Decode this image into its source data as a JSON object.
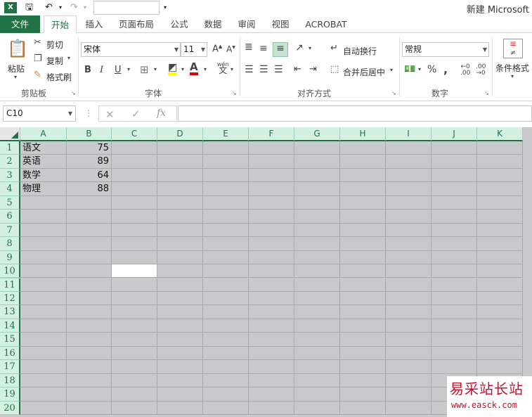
{
  "title_bar": {
    "app_icon": "excel-icon",
    "window_title": "新建 Microsoft"
  },
  "tabs": [
    {
      "label": "文件"
    },
    {
      "label": "开始"
    },
    {
      "label": "插入"
    },
    {
      "label": "页面布局"
    },
    {
      "label": "公式"
    },
    {
      "label": "数据"
    },
    {
      "label": "审阅"
    },
    {
      "label": "视图"
    },
    {
      "label": "ACROBAT"
    }
  ],
  "ribbon": {
    "clipboard": {
      "paste": "粘贴",
      "cut": "剪切",
      "copy": "复制",
      "format_painter": "格式刷",
      "label": "剪贴板"
    },
    "font": {
      "name": "宋体",
      "size": "11",
      "label": "字体",
      "bold": "B",
      "italic": "I",
      "underline": "U",
      "grow": "A",
      "shrink": "A",
      "phonetic_top": "wén",
      "phonetic": "文"
    },
    "alignment": {
      "wrap": "自动换行",
      "merge": "合并后居中",
      "label": "对齐方式"
    },
    "number": {
      "format": "常规",
      "label": "数字",
      "percent": "%",
      "comma": ","
    },
    "styles": {
      "conditional": "条件格式"
    }
  },
  "formula_bar": {
    "name_box": "C10",
    "fx": "fx",
    "value": ""
  },
  "sheet": {
    "columns": [
      "A",
      "B",
      "C",
      "D",
      "E",
      "F",
      "G",
      "H",
      "I",
      "J",
      "K"
    ],
    "rows": [
      "1",
      "2",
      "3",
      "4",
      "5",
      "6",
      "7",
      "8",
      "9",
      "10",
      "11",
      "12",
      "13",
      "14",
      "15",
      "16",
      "17",
      "18",
      "19",
      "20"
    ],
    "data": [
      {
        "row": "1",
        "subject": "语文",
        "score": "75"
      },
      {
        "row": "2",
        "subject": "英语",
        "score": "89"
      },
      {
        "row": "3",
        "subject": "数学",
        "score": "64"
      },
      {
        "row": "4",
        "subject": "物理",
        "score": "88"
      }
    ],
    "selected_cell": "C10"
  },
  "watermark": {
    "line1": "易采站长站",
    "line2": "www.easck.com"
  },
  "colors": {
    "excel_green": "#217346",
    "header_fill": "#d3f0e0",
    "grid_fill": "#c9c8cb"
  }
}
